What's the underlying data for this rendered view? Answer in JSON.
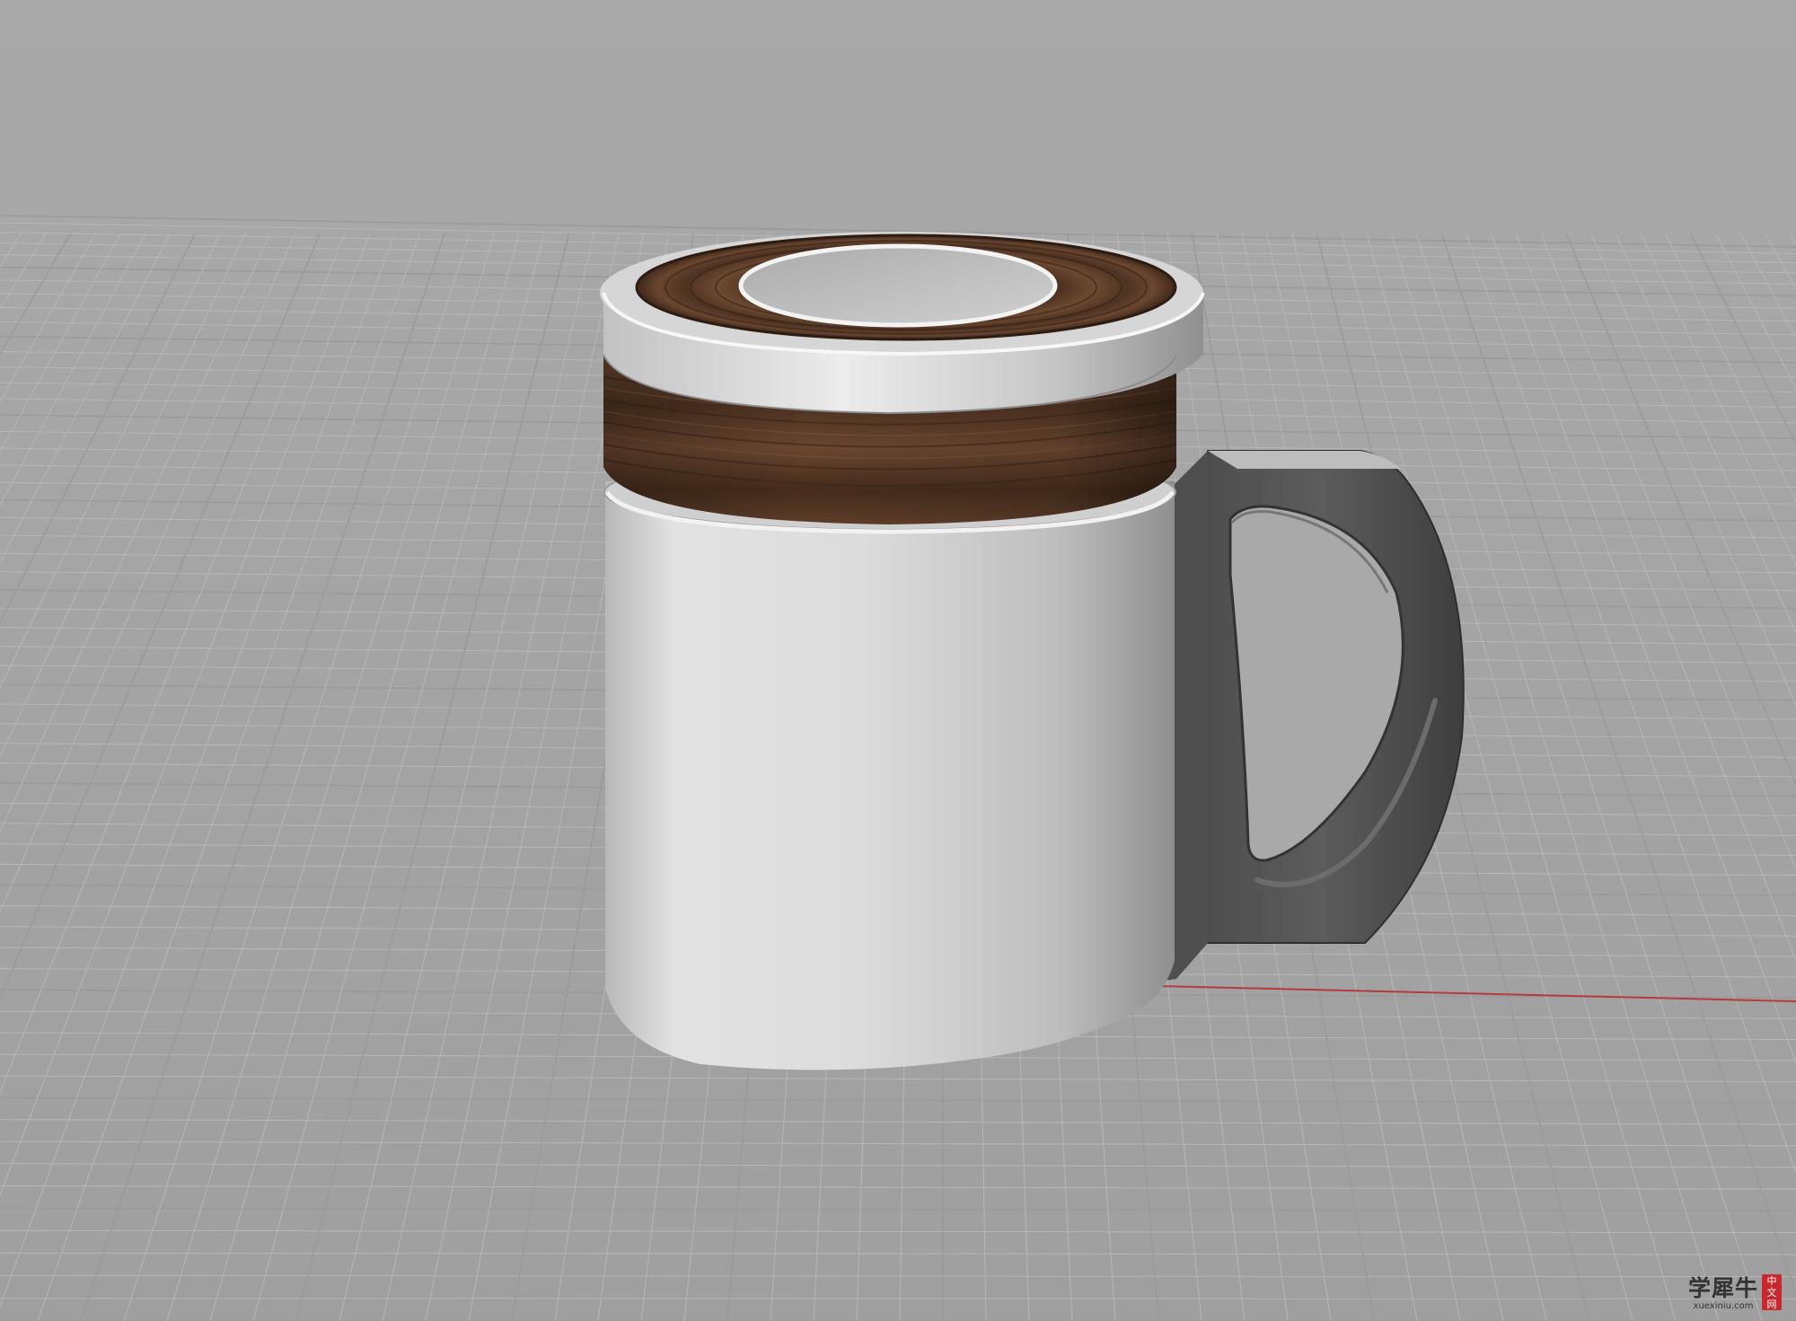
{
  "viewport": {
    "background_color": "#a8a8a8",
    "grid_color": "#b7b7b7",
    "grid_major_color": "#9a9a9a",
    "x_axis_color": "#b83a3a"
  },
  "model": {
    "name": "mug",
    "parts": [
      "lid-top-wood-ring",
      "lid-center-cap",
      "lid-metal-rim",
      "lid-wood-band",
      "mug-body",
      "mug-handle"
    ],
    "colors": {
      "wood": "#5a3a24",
      "metal": "#c8c8c8",
      "body": "#d9d9d9",
      "handle": "#555555"
    }
  },
  "watermark": {
    "name": "学犀牛",
    "site": "xuexiniu.com",
    "seal": [
      "中",
      "文",
      "网"
    ]
  }
}
